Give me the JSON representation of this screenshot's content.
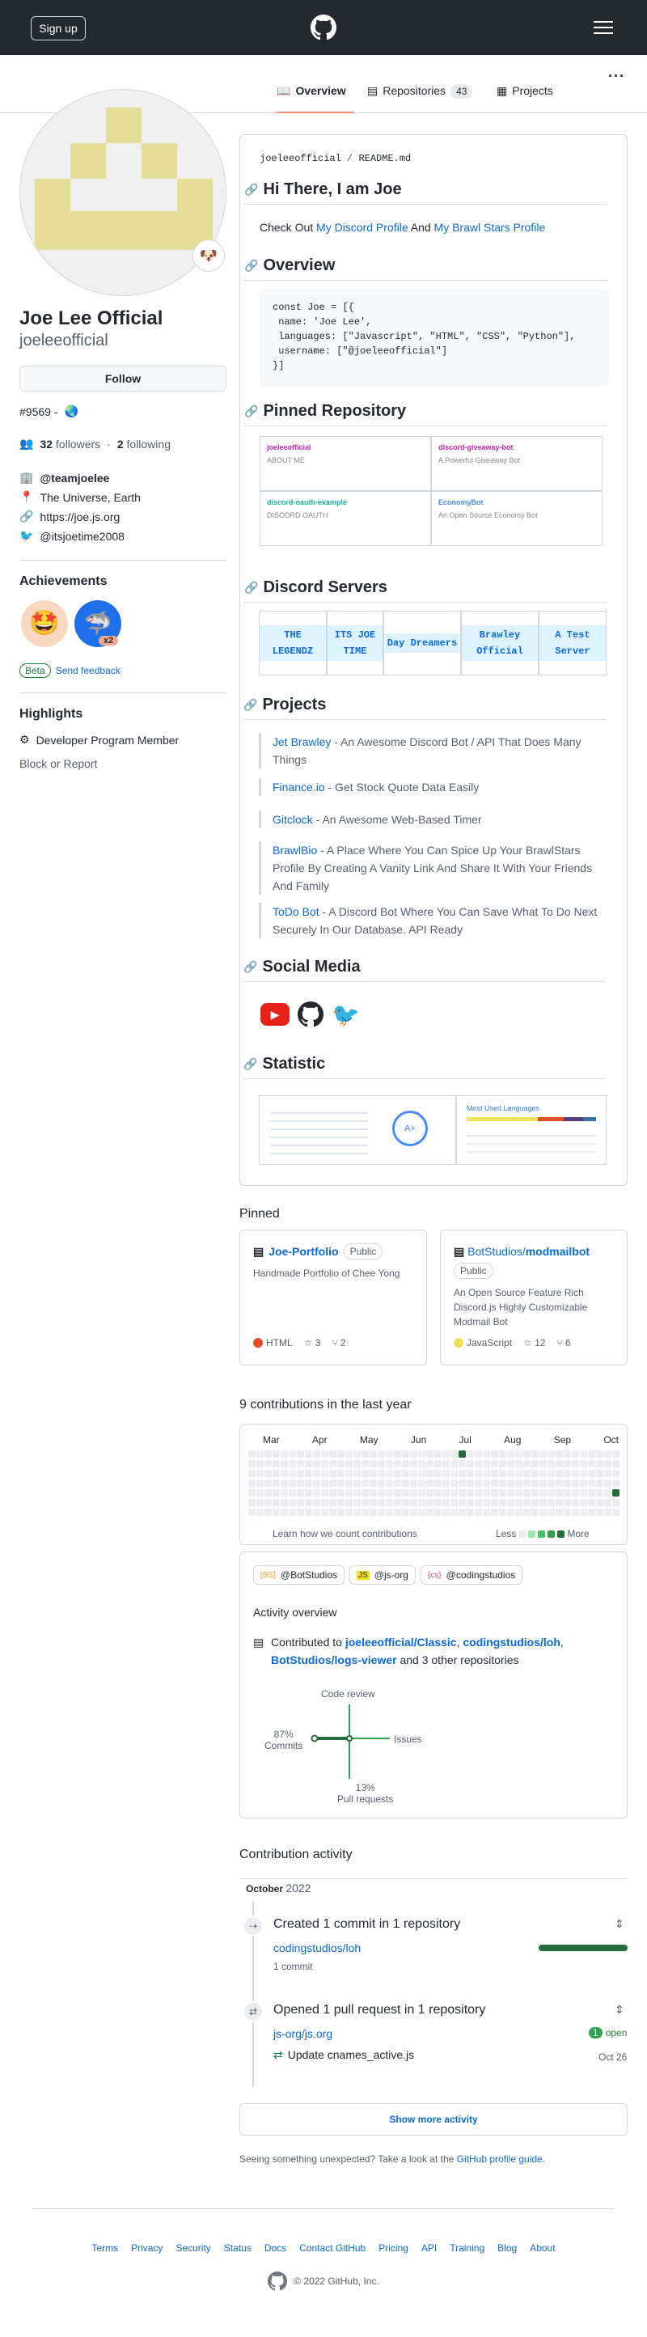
{
  "header": {
    "signup": "Sign up",
    "logo_icon": "github-icon",
    "menu_icon": "hamburger-icon"
  },
  "tabs": [
    {
      "label": "Overview",
      "icon": "book-icon"
    },
    {
      "label": "Repositories",
      "icon": "repo-icon",
      "count": "43"
    },
    {
      "label": "Projects",
      "icon": "table-icon"
    }
  ],
  "profile": {
    "name": "Joe Lee Official",
    "login": "joeleeofficial",
    "follow": "Follow",
    "status": "#9569 - ",
    "followers": "32",
    "followers_label": "followers",
    "following": "2",
    "following_label": "following",
    "org": "@teamjoelee",
    "location": "The Universe, Earth",
    "website": "https://joe.js.org",
    "twitter": "@itsjoetime2008"
  },
  "achievements": {
    "title": "Achievements",
    "x2": "x2",
    "beta": "Beta",
    "feedback": "Send feedback"
  },
  "highlights": {
    "title": "Highlights",
    "item": "Developer Program Member",
    "block": "Block or Report"
  },
  "readme": {
    "path_user": "joeleeofficial",
    "path_sep": "/",
    "path_file": "README.md",
    "h_hi": "Hi There, I am Joe",
    "intro_pre": "Check Out ",
    "intro_link1": "My Discord Profile",
    "intro_mid": " And ",
    "intro_link2": "My Brawl Stars Profile",
    "h_overview": "Overview",
    "code": "const Joe = [{\n name: 'Joe Lee',\n languages: [\"Javascript\", \"HTML\", \"CSS\", \"Python\"],\n username: [\"@joeleeofficial\"]\n}]",
    "h_pinned": "Pinned Repository",
    "pinned": [
      {
        "name": "joeleeofficial",
        "desc": "ABOUT ME",
        "c": "#c724b1"
      },
      {
        "name": "discord-giveaway-bot",
        "desc": "A Powerful Giveaway Bot",
        "c": "#c724b1"
      },
      {
        "name": "discord-oauth-example",
        "desc": "DISCORD OAUTH",
        "c": "#1ab3a6"
      },
      {
        "name": "EconomyBot",
        "desc": "An Open Source Economy Bot",
        "c": "#4a8cff"
      }
    ],
    "h_servers": "Discord Servers",
    "servers": [
      "THE LEGENDZ",
      "ITS JOE TIME",
      "Day Dreamers",
      "Brawley Official",
      "A Test Server"
    ],
    "h_projects": "Projects",
    "projects": [
      {
        "name": "Jet Brawley",
        "desc": " - An Awesome Discord Bot / API That Does Many Things"
      },
      {
        "name": "Finance.io",
        "desc": " - Get Stock Quote Data Easily"
      },
      {
        "name": "Gitclock",
        "desc": " - An Awesome Web-Based Timer"
      },
      {
        "name": "BrawlBio",
        "desc": " - A Place Where You Can Spice Up Your BrawlStars Profile By Creating A Vanity Link And Share It With Your Friends And Family"
      },
      {
        "name": "ToDo Bot",
        "desc": " - A Discord Bot Where You Can Save What To Do Next Securely In Our Database. API Ready"
      }
    ],
    "h_social": "Social Media",
    "h_statistic": "Statistic",
    "grade": "A+",
    "top_langs": "Most Used Languages"
  },
  "pinned_title": "Pinned",
  "pinned_repos": [
    {
      "name": "Joe-Portfolio",
      "owner": "",
      "badge": "Public",
      "desc": "Handmade Portfolio of Chee Yong",
      "lang": "HTML",
      "lang_color": "#e34c26",
      "stars": "3",
      "forks": "2"
    },
    {
      "owner": "BotStudios/",
      "name": "modmailbot",
      "badge": "Public",
      "desc": "An Open Source Feature Rich Discord.js Highly Customizable Modmail Bot",
      "lang": "JavaScript",
      "lang_color": "#f1e05a",
      "stars": "12",
      "forks": "6"
    }
  ],
  "contrib": {
    "title": "9 contributions in the last year",
    "months": [
      "Mar",
      "Apr",
      "May",
      "Jun",
      "Jul",
      "Aug",
      "Sep",
      "Oct"
    ],
    "learn": "Learn how we count contributions",
    "less": "Less",
    "more": "More"
  },
  "orgs": [
    "@BotStudios",
    "@js-org",
    "@codingstudios"
  ],
  "overview": {
    "title": "Activity overview",
    "pre": "Contributed to ",
    "r1": "joeleeofficial/Classic",
    "r2": "codingstudios/loh",
    "r3": "BotStudios/logs-viewer",
    "post": " and 3 other repositories",
    "code_review": "Code review",
    "issues": "Issues",
    "commits_pct": "87%",
    "commits": "Commits",
    "pr_pct": "13%",
    "pr": "Pull requests"
  },
  "activity": {
    "title": "Contribution activity",
    "month": "October",
    "year": "2022",
    "created": "Created 1 commit in 1 repository",
    "repo1": "codingstudios/loh",
    "commits1": "1 commit",
    "opened": "Opened 1 pull request in 1 repository",
    "repo2": "js-org/js.org",
    "open_count": "1",
    "open": "open",
    "pr_title": "Update cnames_active.js",
    "pr_date": "Oct 26",
    "more": "Show more activity",
    "unexpected": "Seeing something unexpected? Take a look at the ",
    "guide": "GitHub profile guide",
    "guide_end": "."
  },
  "footer": {
    "links": [
      "Terms",
      "Privacy",
      "Security",
      "Status",
      "Docs",
      "Contact GitHub",
      "Pricing",
      "API",
      "Training",
      "Blog",
      "About"
    ],
    "copy": "© 2022 GitHub, Inc."
  }
}
